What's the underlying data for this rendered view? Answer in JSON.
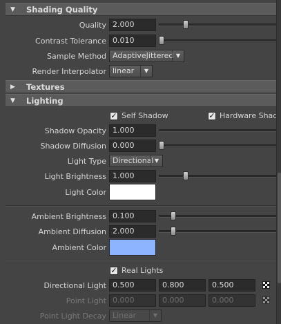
{
  "sections": {
    "shading_quality": {
      "title": "Shading Quality",
      "arrow": "▼"
    },
    "textures": {
      "title": "Textures",
      "arrow": "▶"
    },
    "lighting": {
      "title": "Lighting",
      "arrow": "▼"
    }
  },
  "shading": {
    "quality": {
      "label": "Quality",
      "value": "2.000",
      "slider": 0.25
    },
    "contrast_tolerance": {
      "label": "Contrast Tolerance",
      "value": "0.010",
      "slider": 0.0
    },
    "sample_method": {
      "label": "Sample Method",
      "value": "AdaptiveJittered"
    },
    "render_interpolator": {
      "label": "Render Interpolator",
      "value": "linear"
    }
  },
  "lighting": {
    "self_shadow": {
      "label": "Self Shadow",
      "checked": true
    },
    "hardware_shadow": {
      "label": "Hardware Shadow",
      "checked": true
    },
    "shadow_opacity": {
      "label": "Shadow Opacity",
      "value": "1.000"
    },
    "shadow_diffusion": {
      "label": "Shadow Diffusion",
      "value": "0.000",
      "slider": 0.0
    },
    "light_type": {
      "label": "Light Type",
      "value": "Directional"
    },
    "light_brightness": {
      "label": "Light Brightness",
      "value": "1.000",
      "slider": 0.25
    },
    "light_color": {
      "label": "Light Color",
      "color": "#ffffff"
    },
    "ambient_brightness": {
      "label": "Ambient Brightness",
      "value": "0.100",
      "slider": 0.1
    },
    "ambient_diffusion": {
      "label": "Ambient Diffusion",
      "value": "2.000",
      "slider": 0.1
    },
    "ambient_color": {
      "label": "Ambient Color",
      "color": "#8cb4ff"
    },
    "real_lights": {
      "label": "Real Lights",
      "checked": true
    },
    "directional_light": {
      "label": "Directional Light",
      "values": [
        "0.500",
        "0.800",
        "0.500"
      ]
    },
    "point_light": {
      "label": "Point Light",
      "values": [
        "0.000",
        "0.000",
        "0.000"
      ]
    },
    "point_light_decay": {
      "label": "Point Light Decay",
      "value": "Linear"
    }
  },
  "icons": {
    "check": "✓",
    "dropdown_arrow": "▼",
    "map_button": "checker-map-icon"
  }
}
